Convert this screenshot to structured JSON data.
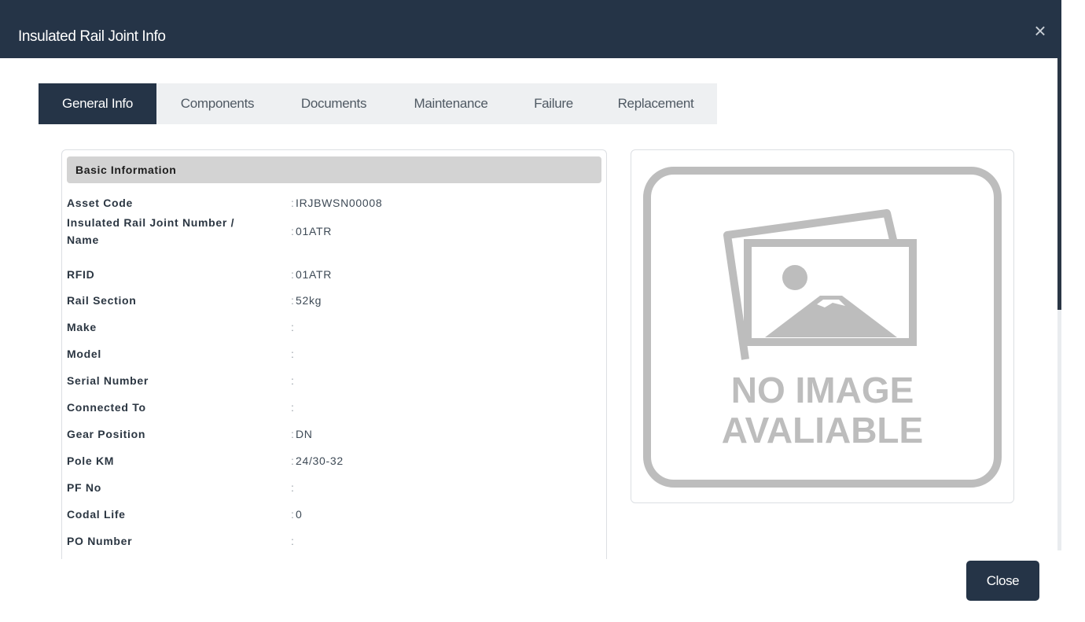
{
  "modal": {
    "title": "Insulated Rail Joint Info",
    "close_icon": "×"
  },
  "tabs": [
    {
      "label": "General Info",
      "active": true
    },
    {
      "label": "Components",
      "active": false
    },
    {
      "label": "Documents",
      "active": false
    },
    {
      "label": "Maintenance",
      "active": false
    },
    {
      "label": "Failure",
      "active": false
    },
    {
      "label": "Replacement",
      "active": false
    }
  ],
  "basic_info": {
    "heading": "Basic Information",
    "rows": [
      {
        "label": "Asset Code",
        "value": "IRJBWSN00008"
      },
      {
        "label_line1": "Insulated Rail Joint Number /",
        "label_line2": "Name",
        "value": "01ATR"
      },
      {
        "label": "RFID",
        "value": "01ATR"
      },
      {
        "label": "Rail Section",
        "value": "52kg"
      },
      {
        "label": "Make",
        "value": ""
      },
      {
        "label": "Model",
        "value": ""
      },
      {
        "label": "Serial Number",
        "value": ""
      },
      {
        "label": "Connected To",
        "value": ""
      },
      {
        "label": "Gear Position",
        "value": "DN"
      },
      {
        "label": "Pole KM",
        "value": "24/30-32"
      },
      {
        "label": "PF No",
        "value": ""
      },
      {
        "label": "Codal Life",
        "value": "0"
      },
      {
        "label": "PO Number",
        "value": ""
      }
    ],
    "separator": ":"
  },
  "image_placeholder": {
    "line1": "NO IMAGE",
    "line2": "AVALIABLE",
    "icon": "no-image-icon"
  },
  "footer": {
    "close_label": "Close"
  },
  "colors": {
    "header_bg": "#253447",
    "tab_inactive_bg": "#eef0f2",
    "section_bg": "#d3d3d3",
    "placeholder_gray": "#bdbdbd"
  }
}
